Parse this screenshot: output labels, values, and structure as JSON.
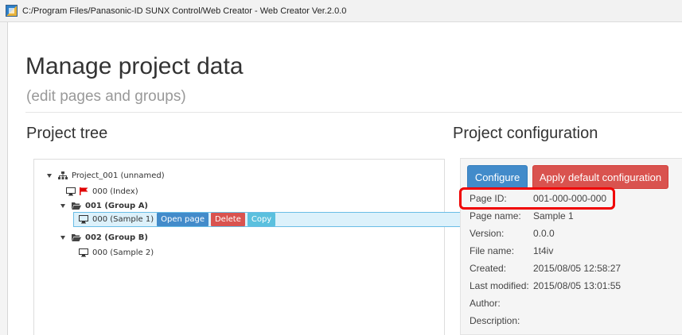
{
  "window": {
    "title": "C:/Program Files/Panasonic-ID SUNX Control/Web Creator - Web Creator Ver.2.0.0"
  },
  "page": {
    "title": "Manage project data",
    "subtitle": "(edit pages and groups)"
  },
  "project_tree": {
    "heading": "Project tree",
    "root_label": "Project_001 (unnamed)",
    "index_page_label": "000 (Index)",
    "group_a_label": "001 (Group A)",
    "group_a_page_label": "000 (Sample 1)",
    "group_b_label": "002 (Group B)",
    "group_b_page_label": "000 (Sample 2)",
    "row_actions": {
      "open_page": "Open page",
      "delete": "Delete",
      "copy": "Copy"
    }
  },
  "project_configuration": {
    "heading": "Project configuration",
    "configure_label": "Configure",
    "apply_default_label": "Apply default configuration",
    "fields": [
      {
        "label": "Page ID:",
        "value": "001-000-000-000"
      },
      {
        "label": "Page name:",
        "value": "Sample 1"
      },
      {
        "label": "Version:",
        "value": "0.0.0"
      },
      {
        "label": "File name:",
        "value": "1t4iv"
      },
      {
        "label": "Created:",
        "value": "2015/08/05 12:58:27"
      },
      {
        "label": "Last modified:",
        "value": "2015/08/05 13:01:55"
      },
      {
        "label": "Author:",
        "value": ""
      },
      {
        "label": "Description:",
        "value": ""
      }
    ]
  },
  "colors": {
    "primary": "#428bca",
    "danger": "#d9534f",
    "info": "#5bc0de",
    "highlight": "#f00000"
  },
  "icons": {
    "app": "app-icon",
    "root": "sitemap-icon",
    "group": "folder-open-icon",
    "page": "monitor-icon",
    "index_marker": "flag-icon"
  }
}
